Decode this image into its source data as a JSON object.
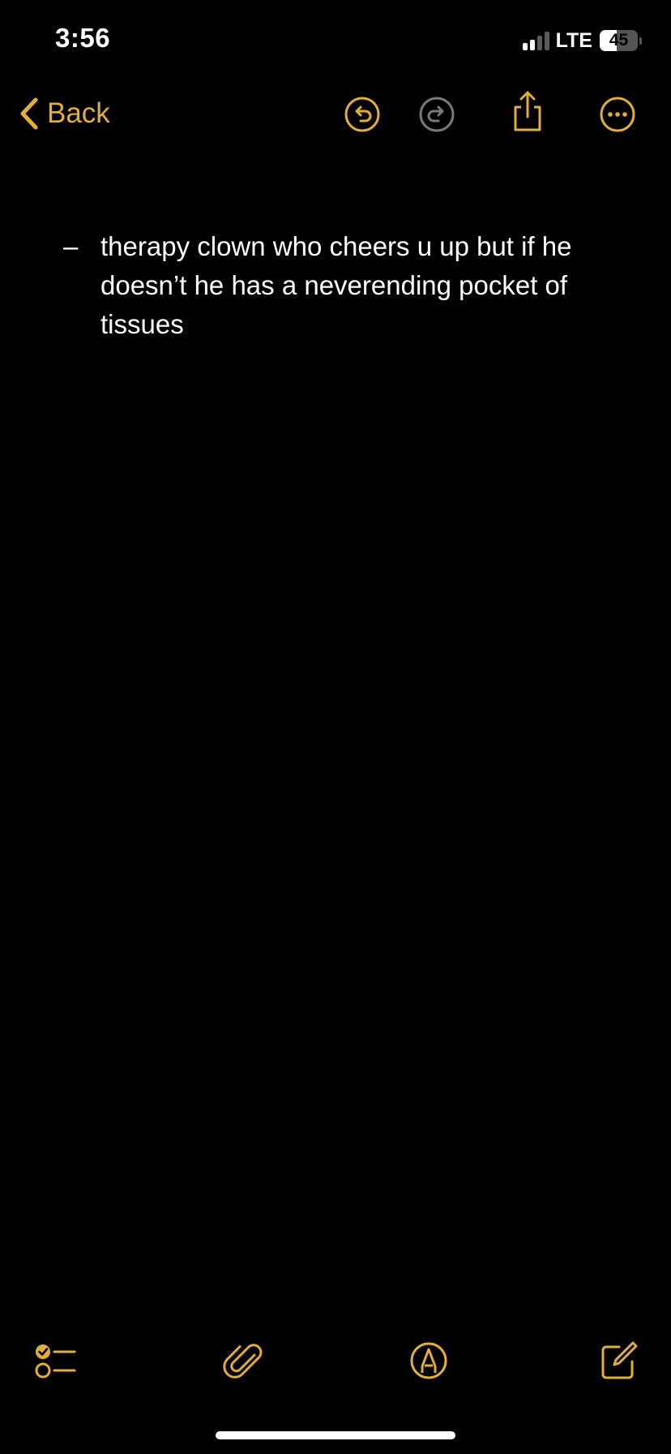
{
  "status_bar": {
    "time": "3:56",
    "network": "LTE",
    "battery_level": "45",
    "battery_fraction": 0.45,
    "signal_bars_active": 2,
    "signal_bars_total": 4
  },
  "nav": {
    "back_label": "Back",
    "icons": [
      "chevron-left-icon",
      "undo-icon",
      "redo-icon",
      "share-icon",
      "more-icon"
    ]
  },
  "note": {
    "items": [
      {
        "bullet": "–",
        "text": "therapy clown who cheers u up but if he doesn’t he has a neverending pocket of tissues"
      }
    ]
  },
  "toolbar": {
    "icons": [
      "checklist-icon",
      "attachment-icon",
      "markup-icon",
      "compose-icon"
    ]
  },
  "colors": {
    "accent": "#E2AE3A",
    "background": "#000000",
    "text": "#FFFFFF",
    "disabled": "#7A7A7A"
  }
}
